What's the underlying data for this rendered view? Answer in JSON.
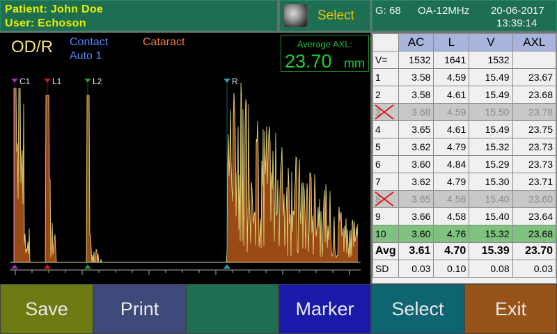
{
  "header": {
    "patient_label": "Patient:",
    "patient_name": "John Doe",
    "user_label": "User:",
    "user_name": "Echoson",
    "probe_select_label": "Select",
    "gain_label": "G:",
    "gain_value": "68",
    "probe_model": "OA-12MHz",
    "date": "20-06-2017",
    "time": "13:39:14"
  },
  "graph": {
    "eye_side": "OD/R",
    "mode_line1": "Contact",
    "mode_line2": "Auto 1",
    "lens_type": "Cataract",
    "avg_axl_title": "Average AXL:",
    "avg_axl_value": "23.70",
    "avg_axl_unit": "mm",
    "markers": [
      {
        "label": "C1",
        "color": "#9b2fb0"
      },
      {
        "label": "L1",
        "color": "#d01818"
      },
      {
        "label": "L2",
        "color": "#1a9a3a"
      },
      {
        "label": "R",
        "color": "#2aa0b8"
      }
    ]
  },
  "table": {
    "headers": [
      "",
      "AC",
      "L",
      "V",
      "AXL"
    ],
    "velocity": {
      "label": "V=",
      "values": [
        "1532",
        "1641",
        "1532",
        ""
      ]
    },
    "rows": [
      {
        "idx": "1",
        "values": [
          "3.58",
          "4.59",
          "15.49",
          "23.67"
        ],
        "state": "normal"
      },
      {
        "idx": "2",
        "values": [
          "3.58",
          "4.61",
          "15.49",
          "23.68"
        ],
        "state": "normal"
      },
      {
        "idx": "3",
        "values": [
          "3.68",
          "4.59",
          "15.50",
          "23.78"
        ],
        "state": "disabled"
      },
      {
        "idx": "4",
        "values": [
          "3.65",
          "4.61",
          "15.49",
          "23.75"
        ],
        "state": "normal"
      },
      {
        "idx": "5",
        "values": [
          "3.62",
          "4.79",
          "15.32",
          "23.73"
        ],
        "state": "normal"
      },
      {
        "idx": "6",
        "values": [
          "3.60",
          "4.84",
          "15.29",
          "23.73"
        ],
        "state": "normal"
      },
      {
        "idx": "7",
        "values": [
          "3.62",
          "4.79",
          "15.30",
          "23.71"
        ],
        "state": "normal"
      },
      {
        "idx": "8",
        "values": [
          "3.65",
          "4.56",
          "15.40",
          "23.60"
        ],
        "state": "disabled"
      },
      {
        "idx": "9",
        "values": [
          "3.66",
          "4.58",
          "15.40",
          "23.64"
        ],
        "state": "normal"
      },
      {
        "idx": "10",
        "values": [
          "3.60",
          "4.76",
          "15.32",
          "23.68"
        ],
        "state": "selected"
      }
    ],
    "avg": {
      "label": "Avg",
      "values": [
        "3.61",
        "4.70",
        "15.39",
        "23.70"
      ]
    },
    "sd": {
      "label": "SD",
      "values": [
        "0.03",
        "0.10",
        "0.08",
        "0.03"
      ]
    }
  },
  "buttons": [
    {
      "label": "Save",
      "color": "#6e7a12"
    },
    {
      "label": "Print",
      "color": "#3e4a7a"
    },
    {
      "label": "",
      "color": "#1e6e52"
    },
    {
      "label": "Marker",
      "color": "#1a1aa8"
    },
    {
      "label": "Select",
      "color": "#0e6470"
    },
    {
      "label": "Exit",
      "color": "#985418"
    }
  ]
}
